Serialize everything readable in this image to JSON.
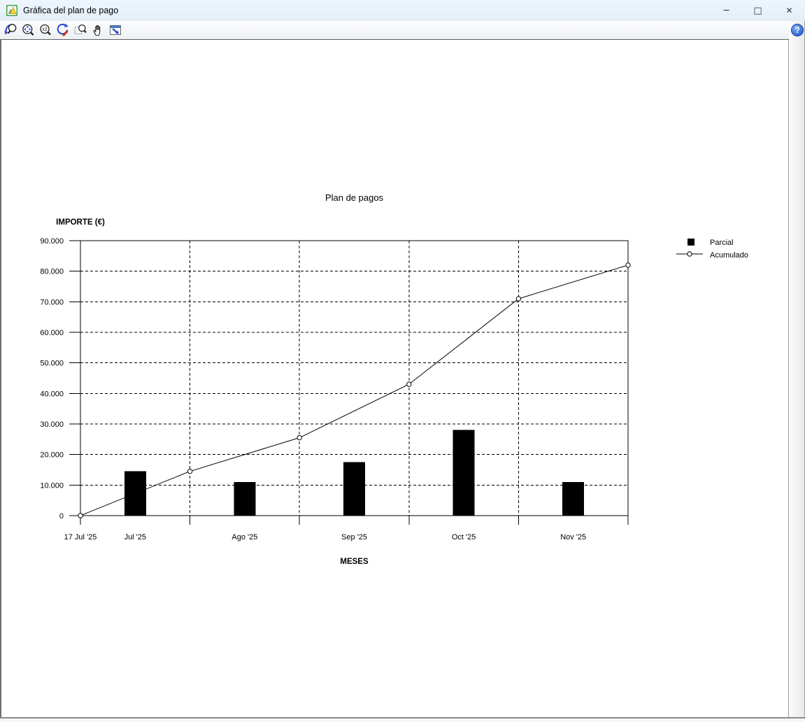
{
  "window": {
    "title": "Gráfica del plan de pago",
    "app_icon": "presto-chart-icon",
    "controls": [
      {
        "name": "minimize",
        "glyph": "─"
      },
      {
        "name": "maximize",
        "glyph": "□"
      },
      {
        "name": "close",
        "glyph": "✕"
      }
    ]
  },
  "toolbar": {
    "buttons": [
      {
        "name": "zoom-previous",
        "icon": "zoom-previous-icon"
      },
      {
        "name": "zoom-extents",
        "icon": "zoom-extents-icon"
      },
      {
        "name": "zoom-2x",
        "icon": "zoom-2x-icon",
        "glyph": "x2"
      },
      {
        "name": "redraw",
        "icon": "redraw-icon"
      },
      {
        "name": "zoom-window",
        "icon": "zoom-window-icon"
      },
      {
        "name": "pan",
        "icon": "pan-hand-icon"
      },
      {
        "name": "fit-to-window",
        "icon": "fit-window-icon"
      }
    ],
    "help": {
      "icon": "help-icon",
      "glyph": "?"
    }
  },
  "chart_data": {
    "type": "combo",
    "title": "Plan de pagos",
    "xlabel": "MESES",
    "ylabel": "IMPORTE (€)",
    "ylim": [
      0,
      90000
    ],
    "ytick_step": 10000,
    "ytick_labels": [
      "0",
      "10.000",
      "20.000",
      "30.000",
      "40.000",
      "50.000",
      "60.000",
      "70.000",
      "80.000",
      "90.000"
    ],
    "x_start_label": "17 Jul '25",
    "categories": [
      "Jul '25",
      "Ago '25",
      "Sep '25",
      "Oct '25",
      "Nov '25"
    ],
    "series": [
      {
        "name": "Parcial",
        "type": "bar",
        "color": "#000000",
        "values": [
          14500,
          11000,
          17500,
          28000,
          11000
        ]
      },
      {
        "name": "Acumulado",
        "type": "line",
        "color": "#000000",
        "marker": "open-circle",
        "values_at_boundaries": [
          0,
          14500,
          25500,
          43000,
          71000,
          82000
        ]
      }
    ],
    "grid": "dashed",
    "legend_position": "right"
  }
}
